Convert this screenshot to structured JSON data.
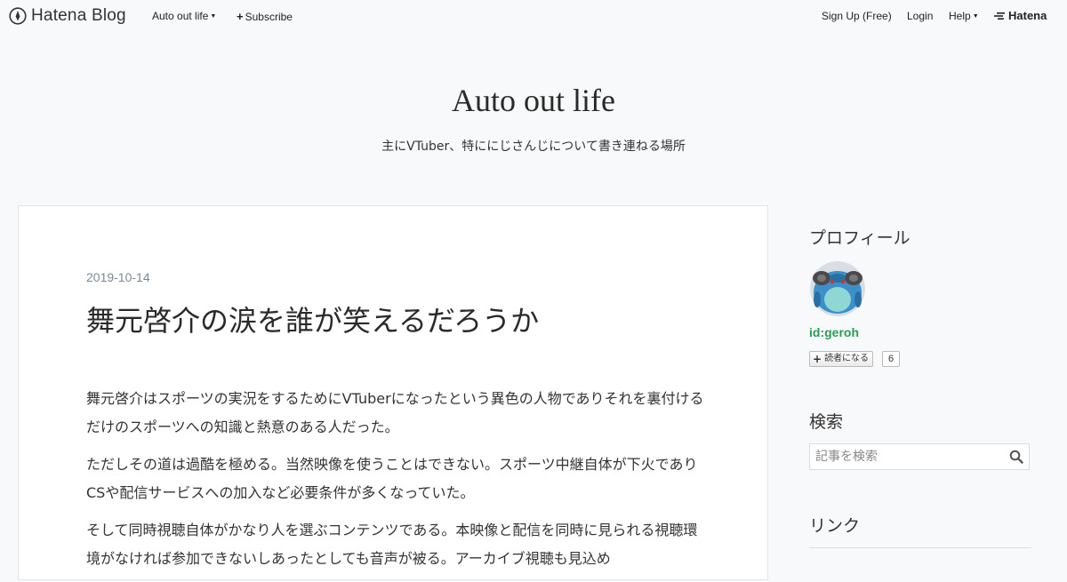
{
  "global_header": {
    "logo_text": "Hatena Blog",
    "blog_menu_label": "Auto out life",
    "subscribe_label": "Subscribe",
    "signup_label": "Sign Up (Free)",
    "login_label": "Login",
    "help_label": "Help",
    "brand_label": "Hatena"
  },
  "blog": {
    "title": "Auto out life",
    "description": "主にVTuber、特ににじさんじについて書き連ねる場所"
  },
  "article": {
    "date": "2019-10-14",
    "title": "舞元啓介の涙を誰が笑えるだろうか",
    "paragraphs": [
      " 舞元啓介はスポーツの実況をするためにVTuberになったという異色の人物でありそれを裏付けるだけのスポーツへの知識と熱意のある人だった。",
      "ただしその道は過酷を極める。当然映像を使うことはできない。スポーツ中継自体が下火でありCSや配信サービスへの加入など必要条件が多くなっていた。",
      "そして同時視聴自体がかなり人を選ぶコンテンツである。本映像と配信を同時に見られる視聴環境がなければ参加できないしあったとしても音声が被る。アーカイブ視聴も見込め"
    ]
  },
  "sidebar": {
    "profile_title": "プロフィール",
    "profile_id": "id:geroh",
    "subscribe_button_label": "読者になる",
    "subscriber_count": "6",
    "search_title": "検索",
    "search_placeholder": "記事を検索",
    "links_title": "リンク"
  },
  "colors": {
    "background": "#f8f9fa",
    "profile_id": "#2a9d56",
    "date": "#7a8a9a"
  }
}
